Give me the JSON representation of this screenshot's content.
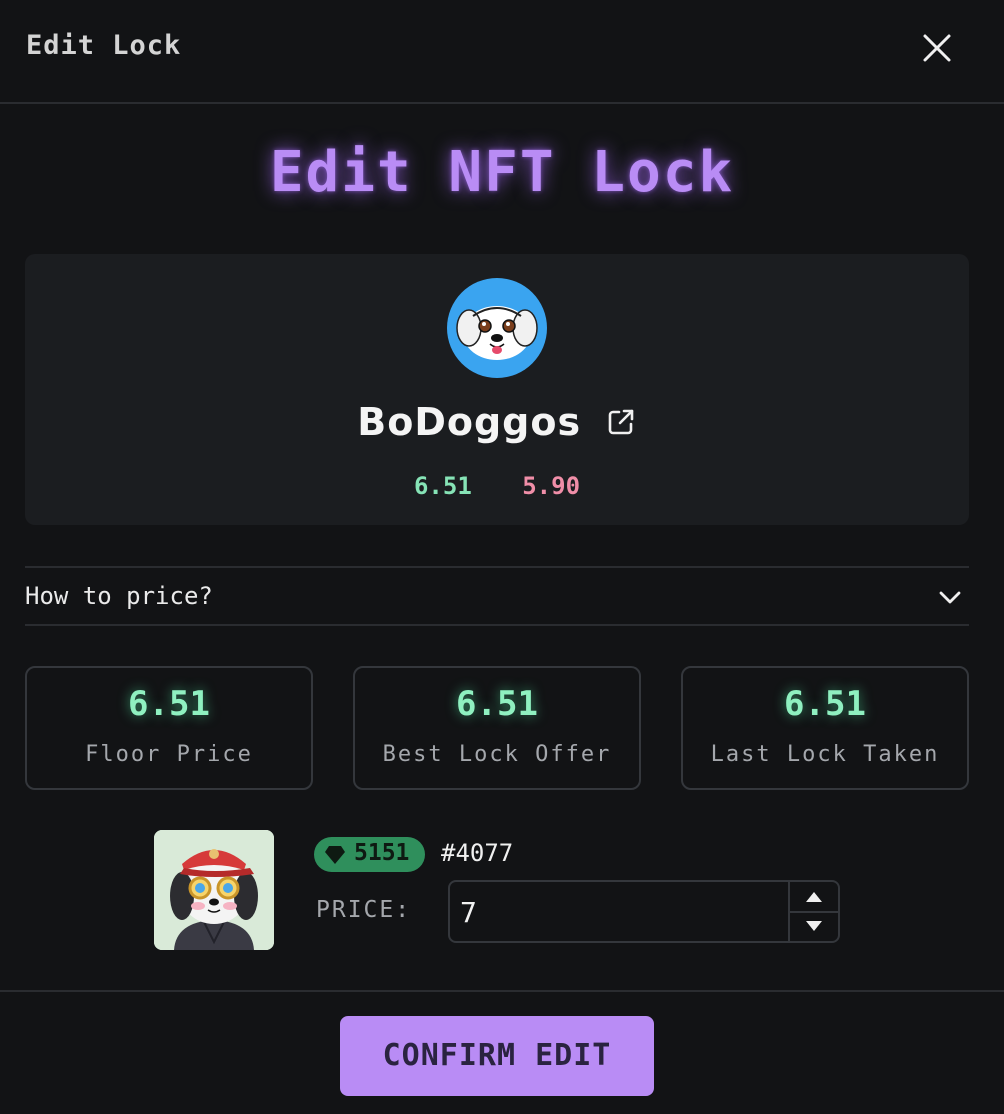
{
  "header": {
    "title": "Edit Lock",
    "close_icon": "close-icon"
  },
  "page_title": "Edit NFT Lock",
  "collection": {
    "name": "BoDoggos",
    "avatar_color": "#3aa4f0",
    "link_icon": "external-link-icon",
    "stat_green": "6.51",
    "stat_pink": "5.90"
  },
  "accordion": {
    "label": "How to price?",
    "icon": "chevron-down-icon"
  },
  "price_boxes": [
    {
      "value": "6.51",
      "label": "Floor Price"
    },
    {
      "value": "6.51",
      "label": "Best Lock Offer"
    },
    {
      "value": "6.51",
      "label": "Last Lock Taken"
    }
  ],
  "nft": {
    "rank": "5151",
    "rank_icon": "gem-icon",
    "id": "#4077",
    "price_label": "PRICE:",
    "price_value": "7"
  },
  "confirm_label": "CONFIRM EDIT",
  "colors": {
    "accent": "#b98cf5",
    "green": "#8ff0c0",
    "pink": "#f08ea8",
    "badge": "#2f8f5c",
    "background": "#121315",
    "card": "#1b1d20"
  }
}
